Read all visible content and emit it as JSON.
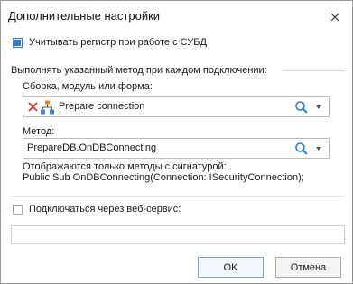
{
  "dialog": {
    "title": "Дополнительные настройки",
    "close_icon": "close-icon"
  },
  "case_sensitive": {
    "label": "Учитывать регистр при работе с СУБД",
    "checked": true
  },
  "on_connect_group": {
    "header": "Выполнять указанный метод при каждом подключении:",
    "assembly_label": "Сборка, модуль или форма:",
    "assembly_value": "Prepare connection",
    "method_label": "Метод:",
    "method_value": "PrepareDB.OnDBConnecting",
    "note_line1": "Отображаются только методы с сигнатурой:",
    "note_line2": "Public Sub OnDBConnecting(Connection: ISecurityConnection);"
  },
  "web_service": {
    "label": "Подключаться через веб-сервис:",
    "checked": false,
    "value": ""
  },
  "buttons": {
    "ok": "OK",
    "cancel": "Отмена"
  },
  "colors": {
    "accent": "#2f7fd1",
    "clear_icon": "#e0312a",
    "tree_icon_blue": "#3b7fd1",
    "tree_icon_orange": "#e88a1a"
  }
}
